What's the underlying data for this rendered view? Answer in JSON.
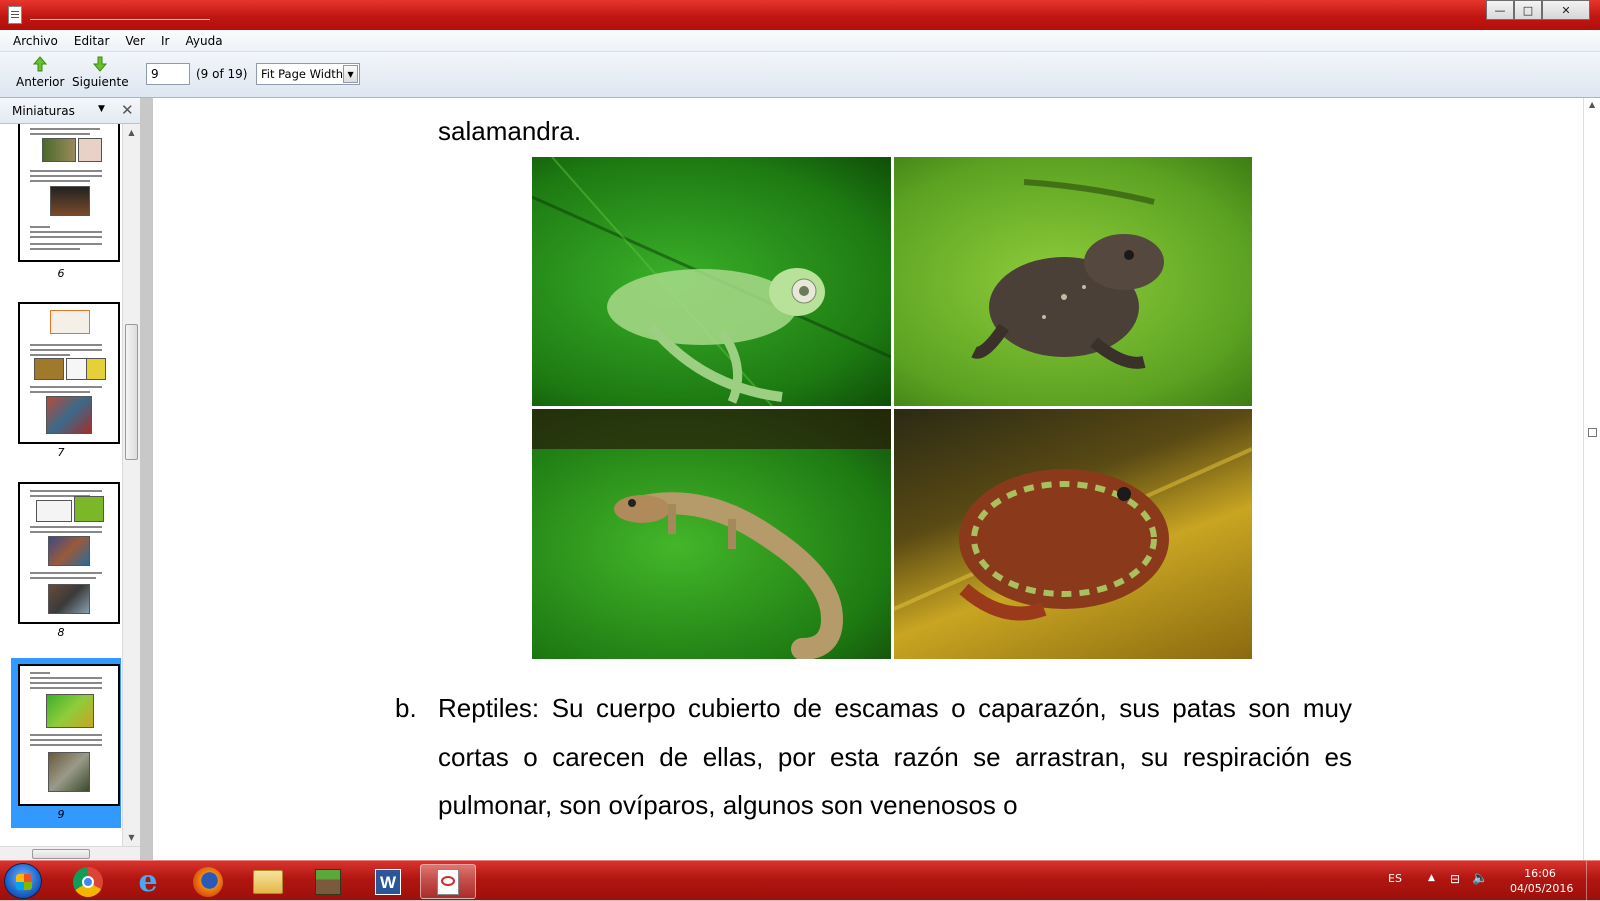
{
  "window": {
    "title": "",
    "controls": {
      "minimize": "—",
      "maximize": "□",
      "close": "✕"
    }
  },
  "menu": {
    "items": [
      "Archivo",
      "Editar",
      "Ver",
      "Ir",
      "Ayuda"
    ]
  },
  "toolbar": {
    "prev_label": "Anterior",
    "next_label": "Siguiente",
    "page_value": "9",
    "page_count": "(9 of 19)",
    "zoom_value": "Fit Page Width"
  },
  "sidebar": {
    "title": "Miniaturas",
    "pages": [
      "6",
      "7",
      "8",
      "9"
    ],
    "selected_page": "9"
  },
  "document": {
    "top_word": "salamandra.",
    "list_letter": "b.",
    "paragraph": "Reptiles: Su cuerpo cubierto de escamas o caparazón, sus patas son muy cortas o carecen de ellas, por esta razón se arrastran, su respiración es pulmonar, son ovíparos, algunos son venenosos o",
    "photos": [
      "glass-frog",
      "brown-toad",
      "salamander",
      "horned-frog"
    ]
  },
  "taskbar": {
    "apps": [
      "chrome",
      "internet-explorer",
      "firefox",
      "file-explorer",
      "minecraft",
      "word",
      "pdf-reader"
    ],
    "active_app": "pdf-reader",
    "language": "ES",
    "time": "16:06",
    "date": "04/05/2016"
  },
  "colors": {
    "titlebar": "#c01612",
    "taskbar": "#b11611",
    "selection": "#3399ff"
  }
}
